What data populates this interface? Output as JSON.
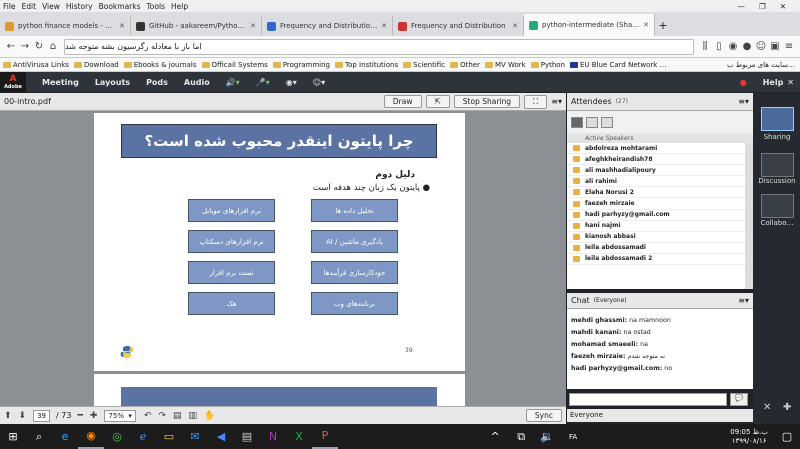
{
  "menubar": [
    "File",
    "Edit",
    "View",
    "History",
    "Bookmarks",
    "Tools",
    "Help"
  ],
  "tabs": [
    {
      "label": "python finance models - …جمع آوری",
      "color": "#d93"
    },
    {
      "label": "GitHub - aakareem/Python-Fin…",
      "color": "#333"
    },
    {
      "label": "Frequency and Distributions | C…",
      "color": "#36c"
    },
    {
      "label": "Frequency and Distribution",
      "color": "#c33"
    },
    {
      "label": "python-intermediate (Sharing)",
      "color": "#2a7"
    }
  ],
  "url": "اما باز با معادله رگرسیون بشه متوجه شد",
  "bookmarks": [
    "AntiVirusa Links",
    "Download",
    "Ebooks & journals",
    "Officail Systems",
    "Programming",
    "Top Institutions",
    "Scientific",
    "Other",
    "MV Work",
    "Python",
    "EU Blue Card Network …",
    "سایت های مربوط ب…"
  ],
  "connect": {
    "logo": "Adobe",
    "menus": [
      "Meeting",
      "Layouts",
      "Pods",
      "Audio"
    ],
    "help": "Help"
  },
  "pod": {
    "title": "00-intro.pdf",
    "draw": "Draw",
    "stop": "Stop Sharing"
  },
  "slide": {
    "title": "چرا پایتون اینقدر محبوب شده است؟",
    "subtitle": "دلیل دوم",
    "bullet": "پایتون یک زبان چند هدفه است",
    "boxes": [
      "تحلیل داده ها",
      "نرم افزارهای موبایل",
      "یادگیری ماشین / AI",
      "نرم افزارهای دسکتاپ",
      "خودکارسازی فرآیندها",
      "تست نرم افزار",
      "برنامه‌های وب",
      "هک"
    ],
    "page_number": "39"
  },
  "bottom": {
    "page": "39",
    "total": "/ 73",
    "zoom": "75%",
    "sync": "Sync"
  },
  "attendees": {
    "title": "Attendees",
    "count": "(27)",
    "active": "Active Speakers",
    "list": [
      "abdolreza mohtarami",
      "afeghkheirandish78",
      "ali mashhadialipoury",
      "ali rahimi",
      "Elaha Norusi 2",
      "faezeh mirzaie",
      "hadi parhyzy@gmail.com",
      "hani najmi",
      "kianosh abbasi",
      "leila abdossamadi",
      "leila abdossamadi 2"
    ]
  },
  "chat": {
    "title": "Chat",
    "scope": "(Everyone)",
    "messages": [
      {
        "from": "mehdi ghassmi:",
        "text": "na mamnoon"
      },
      {
        "from": "mahdi kanani:",
        "text": "na ostad"
      },
      {
        "from": "mohamad smaeeli:",
        "text": "na"
      },
      {
        "from": "faezeh mirzaie:",
        "text": "نه متوجه شدم"
      },
      {
        "from": "hadi parhyzy@gmail.com:",
        "text": "no"
      }
    ],
    "everyone": "Everyone"
  },
  "layouts": [
    "Sharing",
    "Discussion",
    "Collabo…"
  ],
  "clock": {
    "time": "ب.ظ 09:05",
    "date": "۱۳۹۹/۰۸/۱۶",
    "lang": "FA"
  }
}
